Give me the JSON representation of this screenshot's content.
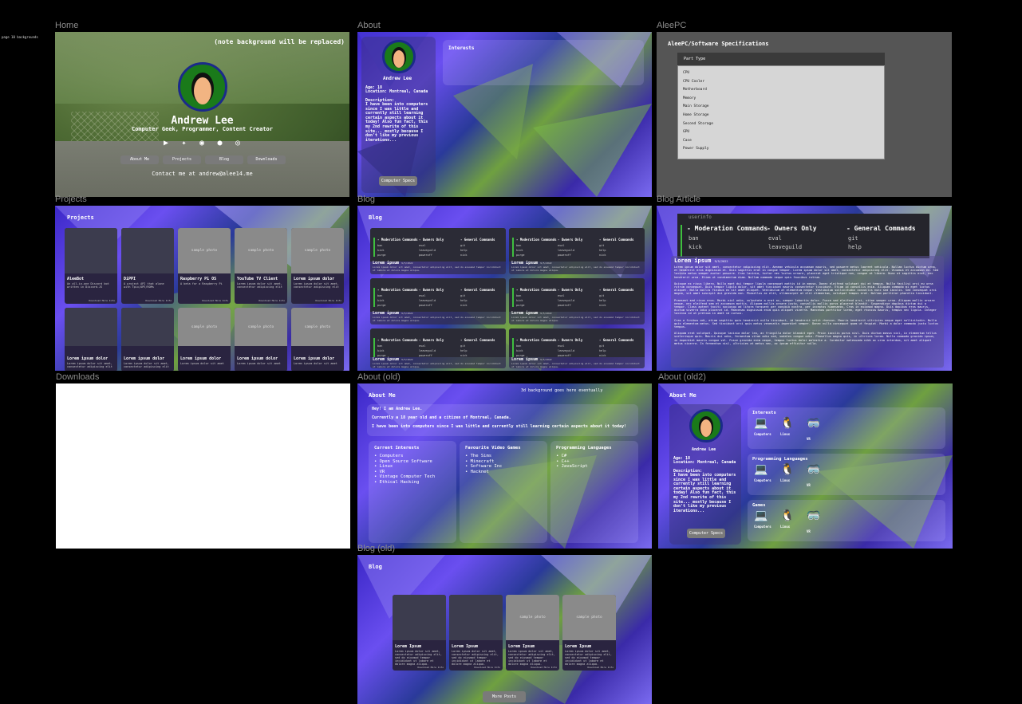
{
  "canvas_note": "page 10 backgrounds",
  "frames": {
    "home": "Home",
    "about": "About",
    "aleepc": "AleePC",
    "projects": "Projects",
    "blog": "Blog",
    "blog_article": "Blog Article",
    "downloads": "Downloads",
    "about_old": "About (old)",
    "about_old2": "About (old2)",
    "blog_old": "Blog (old)"
  },
  "home": {
    "note": "(note background will be replaced)",
    "name": "Andrew Lee",
    "subtitle": "Computer Geek, Programmer, Content Creator",
    "socials": [
      {
        "icon": "youtube-icon",
        "glyph": "▶"
      },
      {
        "icon": "twitter-icon",
        "glyph": "✦"
      },
      {
        "icon": "discord-icon",
        "glyph": "◉"
      },
      {
        "icon": "github-icon",
        "glyph": "●"
      },
      {
        "icon": "instagram-icon",
        "glyph": "◎"
      }
    ],
    "buttons": [
      "About Me",
      "Projects",
      "Blog",
      "Downloads"
    ],
    "contact": "Contact me at andrew@alee14.me"
  },
  "about": {
    "name": "Andrew Lee",
    "age": "Age: 18",
    "location": "Location: Montreal, Canada",
    "desc_label": "Description:",
    "desc": "I have been into computers\nsince I was little and\ncurrently still learning\ncertain aspects about it\ntoday! Also fun fact, this\nmy 2nd rewrite of this\nsite... mostly because I\ndon't like my previous\niterations...",
    "button": "Computer Specs",
    "interests": "Interests"
  },
  "aleepc": {
    "title": "AleePC/Software Specifications",
    "header": "Part Type",
    "parts": [
      "CPU",
      "CPU Cooler",
      "Motherboard",
      "Memory",
      "Main Storage",
      "Home Storage",
      "Second Storage",
      "GPU",
      "Case",
      "Power Supply"
    ]
  },
  "projects": {
    "title": "Projects",
    "cards": [
      {
        "title": "AleeBot",
        "desc": "An all-in-one Discord bot written in Discord.JS",
        "photo": "",
        "foot": "Download  More Info"
      },
      {
        "title": "DiPPI",
        "desc": "A project API that alone with Tpix/APE/ROMs",
        "photo": "",
        "foot": "Download  More Info"
      },
      {
        "title": "Raspberry Pi OS",
        "desc": "A beta for a Raspberry Pi",
        "photo": "sample photo",
        "foot": "Download  More Info"
      },
      {
        "title": "YouTube TV Client",
        "desc": "Lorem ipsum dolor sit amet, consectetur adipiscing elit",
        "photo": "sample photo",
        "foot": "Download  More Info"
      },
      {
        "title": "Lorem ipsum dolor",
        "desc": "Lorem ipsum dolor sit amet, consectetur adipiscing elit",
        "photo": "sample photo",
        "foot": "Download  More Info"
      },
      {
        "title": "Lorem ipsum dolor",
        "desc": "Lorem ipsum dolor sit amet, consectetur adipiscing elit",
        "photo": "",
        "foot": ""
      },
      {
        "title": "Lorem ipsum dolor",
        "desc": "Lorem ipsum dolor sit amet, consectetur adipiscing elit",
        "photo": "",
        "foot": ""
      },
      {
        "title": "Lorem ipsum dolor",
        "desc": "Lorem ipsum dolor sit amet",
        "photo": "sample photo",
        "foot": ""
      },
      {
        "title": "Lorem ipsum dolor",
        "desc": "Lorem ipsum dolor sit amet",
        "photo": "sample photo",
        "foot": ""
      },
      {
        "title": "Lorem ipsum dolor",
        "desc": "Lorem ipsum dolor sit amet",
        "photo": "sample photo",
        "foot": ""
      }
    ]
  },
  "blog": {
    "title": "Blog",
    "post_title": "Lorem ipsum",
    "post_date": "9/5/2022",
    "post_desc": "Lorem ipsum dolor sit amet, consectetur adipiscing elit, sed do eiusmod tempor incididunt ut labore et dolore magna aliqua.",
    "cmd_headers": [
      "- Moderation Commands",
      "- Owners Only",
      "- General Commands"
    ],
    "cmd_rows": [
      [
        "ban",
        "eval",
        "git"
      ],
      [
        "kick",
        "leaveguild",
        "help"
      ],
      [
        "purge",
        "poweroff",
        "nick"
      ]
    ]
  },
  "article": {
    "userinfo": "userinfo",
    "cmd_headers": [
      "- Moderation Commands",
      "- Owners Only",
      "- General Commands"
    ],
    "cmd_rows": [
      [
        "ban",
        "eval",
        "git"
      ],
      [
        "kick",
        "leaveguild",
        "help"
      ]
    ],
    "title": "Lorem ipsum",
    "date": "9/5/2022",
    "paragraphs": [
      "Lorem ipsum dolor sit amet, consectetur adipiscing elit. Aenean vehicula accumsan mauris, sed posuere metus laoreet vehicula. Nullam luctus dictum urna, et hendrerit eros dignissim et. Duis sagittis erat in congue tempor. Lorem ipsum dolor sit amet, consectetur adipiscing elit. Vivamus et accumsan ex. Sed lacinia metus semper auctor posuere. Cras lacinia, tortor nec luctus ornare, placerat eget tristique non, congue at libero. Nunc et sagittis erat, nec hendrerit urna. Etiam ut condimentum diam. Nullam commodo neque quis faucibus rutrum.",
      "Quisque ex risus libero. Nulla eget dui tempor ligula consequat mattis id in massa. Donec eleifend volutpat dui et tempus. Nulla facilisi orci eu urna rutrum consequat. Duis tempor ligula dolor, sit amet tincidunt mauris consectetur tincidunt. Etiam id convallis enim. Aliquam commodo mi eget luctus aliquet. Nulla mollis finibus ex sit amet aliquet. Vestibulum at elementum neque. Vestibulum sollicitudin convallis nunc sed iaculis. Sed consequat orci magna, sit amet suscipit dui gravida non. Phasellus ac elit, ullamcorper at elit elementum, volutpat tempus erat. Nullam porttitor pharetra tincidunt.",
      "Praesent sed risus eros. Morbi nisl odio, vulputate a erat ac, semper lobortis dolor. Fusce sed eleifend orci, vitae semper urna. Aliquam mollis ornare neque, nec eleifend sem et accumsan mattis. Aliquam mollis ornare justo, convallis mollis purus placerat blandit. Suspendisse dapibus dictum dui a tempor. Class aptent taciti sociosqu ad litora torquent per conubia nostra, per inceptos himenaeos. Cras in euismod magna. Duis dapibus eros mauris, dictum viverra odio placerat id. Maecenas dignissim enim quis aliquet viverra. Maecenas porttitor lorem, eget rhoncus mauris, tempus nec ligula. Integer lacinia id ut pretium in amet id cursus.",
      "Cras a finibus odi, etiam sagittis quis hendrerit nulla tincidunt, id hendrerit velit rhoncus. Mauris hendrerit ultricies neque eget sollicitudin. Nulla quis elementum metus. Sed tincidunt orci quis metus venenatis imperdiet semper. Donec nulla consequat quam ut feugiat. Morbi a dolor commodo justo luctus tempus.",
      "Aliquam erat volutpat. Quisque lacinia dolor leo, ac fringilla dolor blandit eget. Proin iaculis purus nisl. Duis dictum massa nisl, in elementum tellus scelerisque quis. Mauris dui odio, fermentum vitae odio sed, sodales congue odio. Phasellus magna quis, in ultrices lorem. Nulla commodo gravida ipsum, in imperdiet mauris congue vel. Fusce gravida enim neque, tempus luctus dolor molestie a. Curabitur malesuada nibh ac urna interdum, sit amet aliquet metus viverra. In fermentum nisl, ultricies at metus nec, ac ipsum efficitur nulla."
    ]
  },
  "about_old": {
    "title": "About Me",
    "bg_note": "3d background goes here eventually",
    "intro": "Hey! I am Andrew Lee.",
    "line2": "Currently a 18 year old and a citizen of Montreal, Canada.",
    "line3": "I have been into computers since I was little and currently still learning certain aspects about it today!",
    "columns": [
      {
        "title": "Current Interests",
        "items": [
          "Computers",
          "Open Source Software",
          "Linux",
          "VR",
          "Vintage Computer Tech",
          "Ethical Hacking"
        ]
      },
      {
        "title": "Favourite Video Games",
        "items": [
          "The Sims",
          "Minecraft",
          "Software Inc",
          "Hacknet"
        ]
      },
      {
        "title": "Programming Languages",
        "items": [
          "C#",
          "C++",
          "JavaScript"
        ]
      }
    ]
  },
  "about_old2": {
    "title": "About Me",
    "name": "Andrew Lee",
    "age": "Age: 18",
    "location": "Location: Montreal, Canada",
    "desc_label": "Description:",
    "desc": "I have been into computers\nsince I was little and\ncurrently still learning\ncertain aspects about it\ntoday! Also fun fact, this\nmy 2nd rewrite of this\nsite... mostly because I\ndon't like my previous\niterations...",
    "button": "Computer Specs",
    "sections": [
      {
        "title": "Interests",
        "icons": [
          "Computers",
          "Linux",
          "VR"
        ]
      },
      {
        "title": "Programming Languages",
        "icons": [
          "Computers",
          "Linux",
          "VR"
        ]
      },
      {
        "title": "Games",
        "icons": [
          "Computers",
          "Linux",
          "VR"
        ]
      }
    ]
  },
  "blog_old": {
    "title": "Blog",
    "cards": [
      {
        "title": "Lorem Ipsum",
        "photo": ""
      },
      {
        "title": "Lorem Ipsum",
        "photo": ""
      },
      {
        "title": "Lorem Ipsum",
        "photo": "sample photo"
      },
      {
        "title": "Lorem Ipsum",
        "photo": "sample photo"
      }
    ],
    "card_desc": "Lorem ipsum dolor sit amet, consectetur adipiscing elit, sed do eiusmod tempor incididunt ut labore et dolore magna aliqua.",
    "card_foot": "Download  More Info",
    "more_button": "More Posts"
  }
}
